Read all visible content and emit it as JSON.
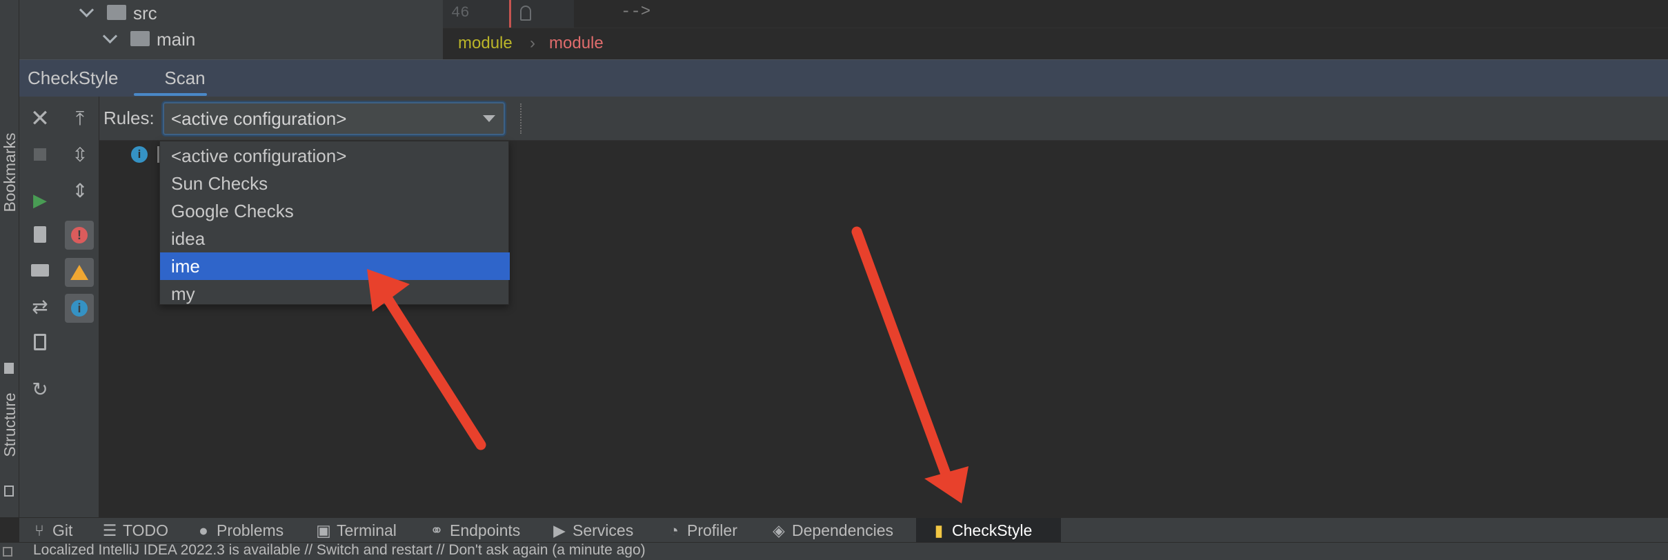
{
  "left_strip": {
    "bookmarks_label": "Bookmarks",
    "structure_label": "Structure"
  },
  "project_tree": {
    "items": [
      {
        "label": "src"
      },
      {
        "label": "main"
      }
    ]
  },
  "editor": {
    "line_number": "46",
    "code_line": "-->",
    "breadcrumb": {
      "first": "module",
      "separator": "›",
      "second": "module"
    },
    "breadcrumb_colors": {
      "first": "#bbb529",
      "second": "#e06c6c"
    }
  },
  "tool_window": {
    "tabs": [
      {
        "label": "CheckStyle"
      },
      {
        "label": "Scan",
        "active": true
      }
    ]
  },
  "rules": {
    "label": "Rules:",
    "selected": "<active configuration>",
    "options": [
      {
        "label": "<active configuration>"
      },
      {
        "label": "Sun Checks"
      },
      {
        "label": "Google Checks"
      },
      {
        "label": "idea"
      },
      {
        "label": "ime",
        "highlighted": true
      },
      {
        "label": "my"
      }
    ]
  },
  "bottom_bar": {
    "tabs": [
      {
        "label": "Git",
        "icon": "git-branch-icon"
      },
      {
        "label": "TODO",
        "icon": "list-icon"
      },
      {
        "label": "Problems",
        "icon": "problems-icon"
      },
      {
        "label": "Terminal",
        "icon": "terminal-icon"
      },
      {
        "label": "Endpoints",
        "icon": "endpoints-icon"
      },
      {
        "label": "Services",
        "icon": "services-icon"
      },
      {
        "label": "Profiler",
        "icon": "profiler-icon"
      },
      {
        "label": "Dependencies",
        "icon": "dependencies-icon"
      },
      {
        "label": "CheckStyle",
        "icon": "checkstyle-icon",
        "active": true
      }
    ]
  },
  "status_bar": {
    "message": "Localized IntelliJ IDEA 2022.3 is available // Switch and restart // Don't ask again (a minute ago)"
  },
  "colors": {
    "accent": "#2f65ca",
    "annotation_arrow": "#e8412c",
    "tab_underline": "#4a88c7"
  }
}
